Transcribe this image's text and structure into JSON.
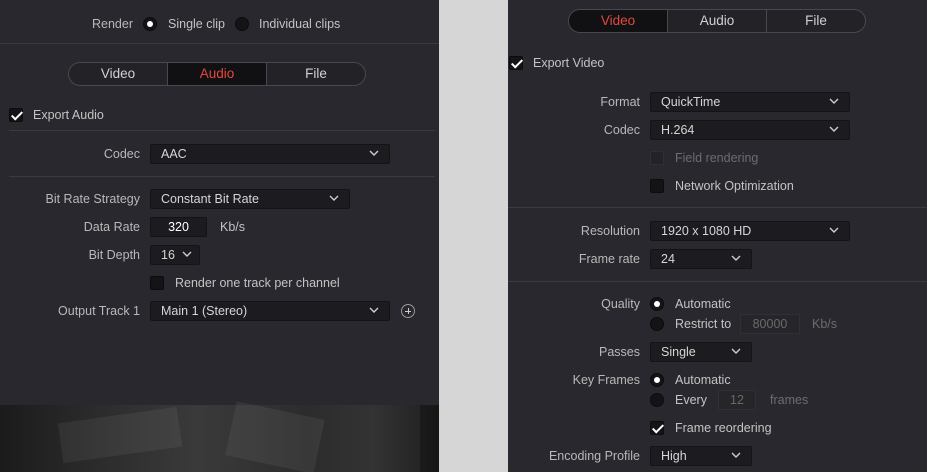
{
  "left": {
    "render": {
      "label": "Render",
      "options": [
        "Single clip",
        "Individual clips"
      ],
      "selected": "Single clip"
    },
    "tabs": [
      {
        "label": "Video",
        "active": false
      },
      {
        "label": "Audio",
        "active": true
      },
      {
        "label": "File",
        "active": false
      }
    ],
    "export_audio": {
      "label": "Export Audio",
      "checked": true
    },
    "codec": {
      "label": "Codec",
      "value": "AAC"
    },
    "bit_rate_strategy": {
      "label": "Bit Rate Strategy",
      "value": "Constant Bit Rate"
    },
    "data_rate": {
      "label": "Data Rate",
      "value": "320",
      "unit": "Kb/s"
    },
    "bit_depth": {
      "label": "Bit Depth",
      "value": "16"
    },
    "render_one_track": {
      "label": "Render one track per channel",
      "checked": false
    },
    "output_track": {
      "label": "Output Track 1",
      "value": "Main 1 (Stereo)"
    }
  },
  "right": {
    "tabs": [
      {
        "label": "Video",
        "active": true
      },
      {
        "label": "Audio",
        "active": false
      },
      {
        "label": "File",
        "active": false
      }
    ],
    "export_video": {
      "label": "Export Video",
      "checked": true
    },
    "format": {
      "label": "Format",
      "value": "QuickTime"
    },
    "codec": {
      "label": "Codec",
      "value": "H.264"
    },
    "field_rendering": {
      "label": "Field rendering",
      "checked": false,
      "enabled": false
    },
    "network_optimization": {
      "label": "Network Optimization",
      "checked": false
    },
    "resolution": {
      "label": "Resolution",
      "value": "1920 x 1080 HD"
    },
    "frame_rate": {
      "label": "Frame rate",
      "value": "24"
    },
    "quality": {
      "label": "Quality",
      "automatic_label": "Automatic",
      "restrict_label": "Restrict to",
      "restrict_value": "80000",
      "restrict_unit": "Kb/s",
      "selected": "Automatic"
    },
    "passes": {
      "label": "Passes",
      "value": "Single"
    },
    "key_frames": {
      "label": "Key Frames",
      "automatic_label": "Automatic",
      "every_label": "Every",
      "every_value": "12",
      "every_unit": "frames",
      "selected": "Automatic"
    },
    "frame_reordering": {
      "label": "Frame reordering",
      "checked": true
    },
    "encoding_profile": {
      "label": "Encoding Profile",
      "value": "High"
    }
  },
  "colors": {
    "accent": "#e4483c",
    "panel": "#28282e",
    "field": "#1c1c20"
  },
  "icons": [
    "chevron-down-icon",
    "add-track-icon",
    "checkmark-icon",
    "radio-icon"
  ]
}
